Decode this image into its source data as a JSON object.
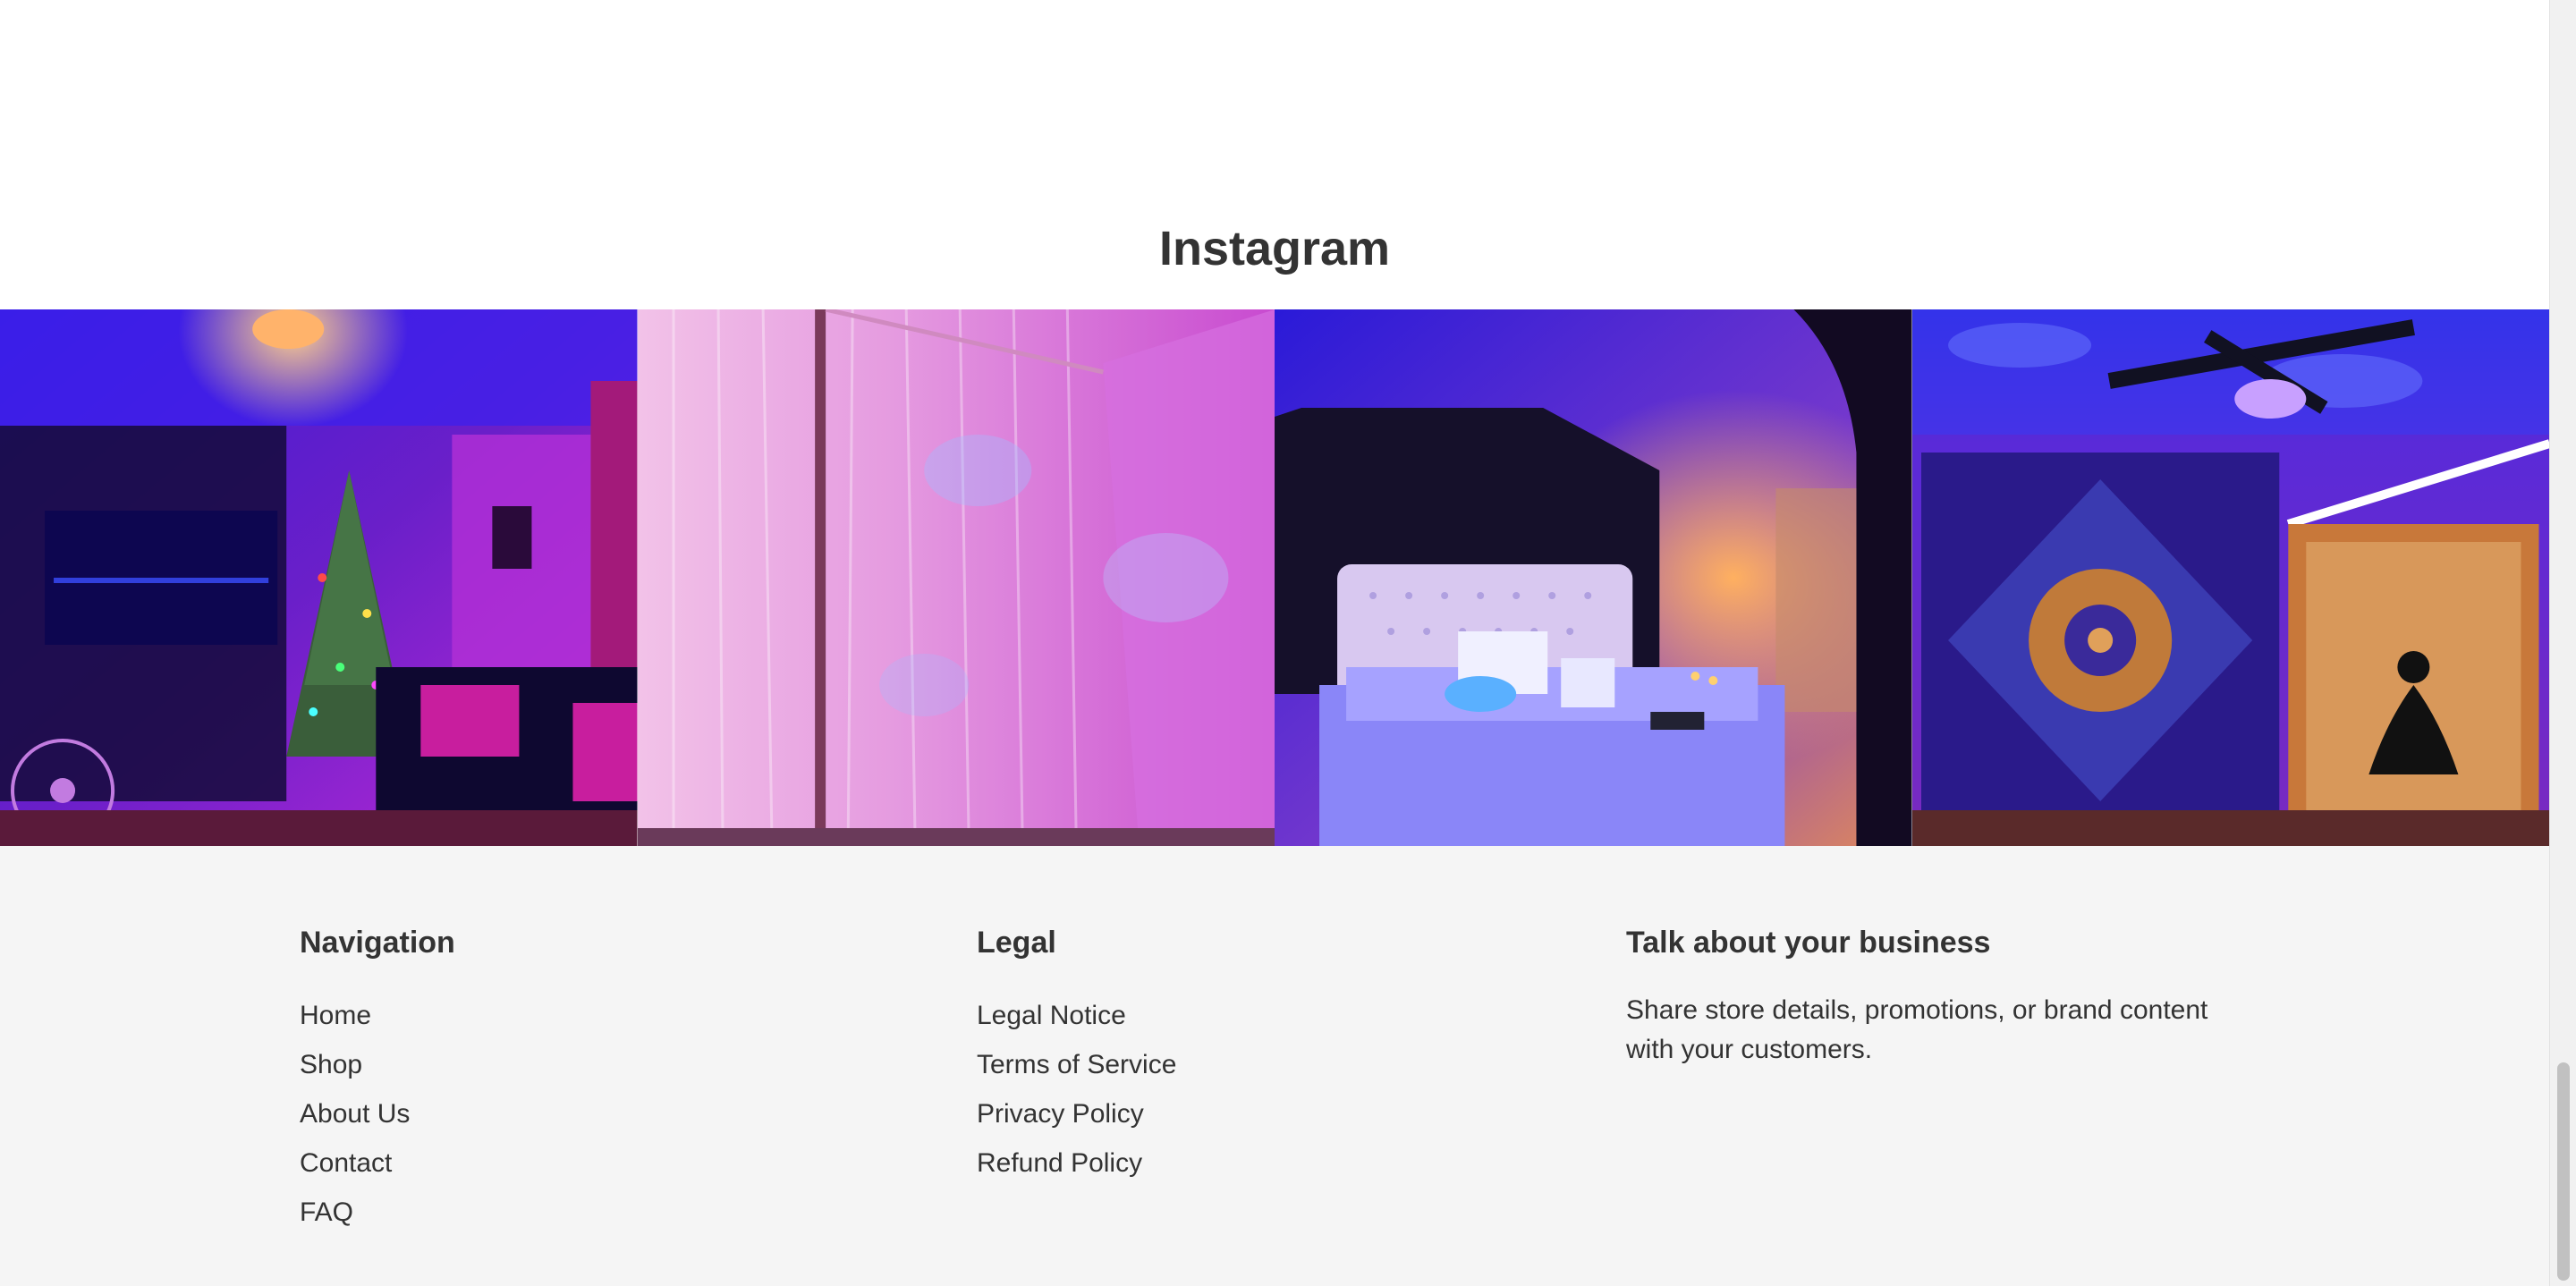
{
  "instagram": {
    "title": "Instagram",
    "images": [
      {
        "name": "galaxy-projector-living-room-christmas-tree"
      },
      {
        "name": "pink-curtains-water-ripple-light"
      },
      {
        "name": "starry-ceiling-bedroom-white-headboard"
      },
      {
        "name": "tapestry-wall-starry-ceiling-fan"
      }
    ]
  },
  "footer": {
    "navigation": {
      "heading": "Navigation",
      "links": [
        "Home",
        "Shop",
        "About Us",
        "Contact",
        "FAQ"
      ]
    },
    "legal": {
      "heading": "Legal",
      "links": [
        "Legal Notice",
        "Terms of Service",
        "Privacy Policy",
        "Refund Policy"
      ]
    },
    "talk": {
      "heading": "Talk about your business",
      "text": "Share store details, promotions, or brand content with your customers."
    }
  },
  "colors": {
    "text": "#333333",
    "footer_bg": "#f5f5f5",
    "page_bg": "#ffffff"
  }
}
